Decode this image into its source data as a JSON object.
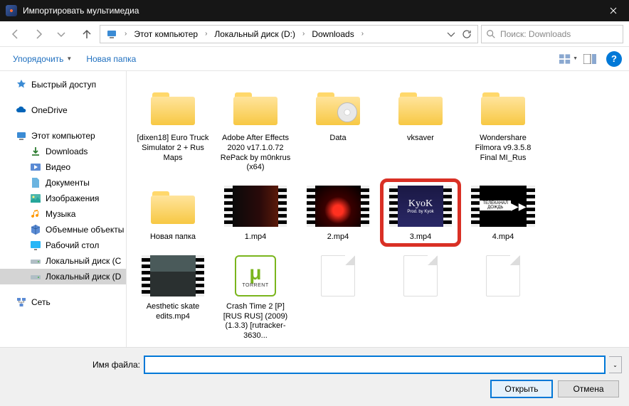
{
  "window": {
    "title": "Импортировать мультимедиа"
  },
  "breadcrumb": {
    "root": "Этот компьютер",
    "drive": "Локальный диск (D:)",
    "folder": "Downloads"
  },
  "search": {
    "placeholder": "Поиск: Downloads"
  },
  "toolbar": {
    "organize": "Упорядочить",
    "newfolder": "Новая папка"
  },
  "sidebar": {
    "quick": "Быстрый доступ",
    "onedrive": "OneDrive",
    "thispc": "Этот компьютер",
    "downloads": "Downloads",
    "video": "Видео",
    "documents": "Документы",
    "images": "Изображения",
    "music": "Музыка",
    "objects3d": "Объемные объекты",
    "desktop": "Рабочий стол",
    "localC": "Локальный диск (С",
    "localD": "Локальный диск (D",
    "network": "Сеть"
  },
  "files": {
    "f1": "[dixen18] Euro Truck Simulator 2 + Rus Maps",
    "f2": "Adobe After Effects 2020 v17.1.0.72 RePack by m0nkrus (x64)",
    "f3": "Data",
    "f4": "vksaver",
    "f5": "Wondershare Filmora v9.3.5.8 Final MI_Rus",
    "f6": "Новая папка",
    "v1": "1.mp4",
    "v2": "2.mp4",
    "v3": "3.mp4",
    "v4": "4.mp4",
    "v5": "Aesthetic skate edits.mp4",
    "t1": "Crash Time 2 [P] [RUS RUS] (2009) (1.3.3) [rutracker-3630...",
    "torrent_label": "TORRENT"
  },
  "footer": {
    "filename_label": "Имя файла:",
    "filename_value": "",
    "open": "Открыть",
    "cancel": "Отмена"
  }
}
